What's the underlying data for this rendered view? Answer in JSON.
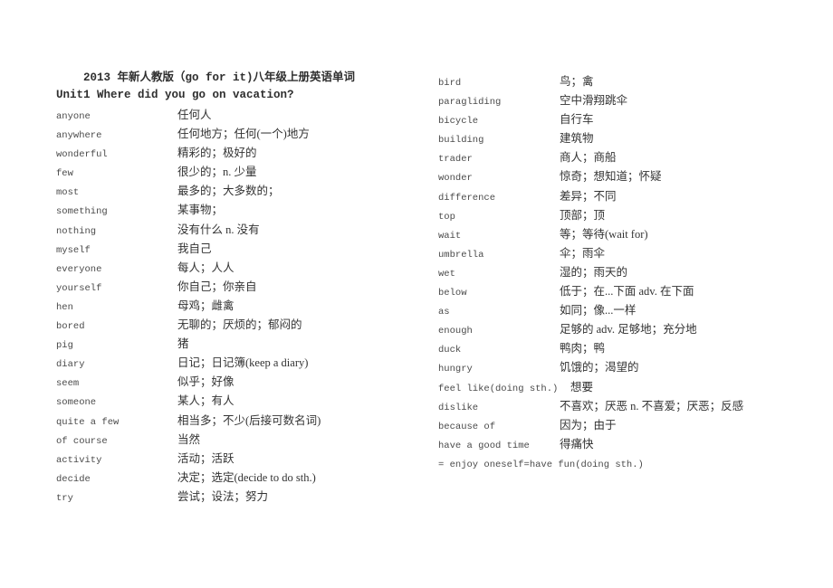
{
  "document": {
    "title": "2013 年新人教版（go for it)八年级上册英语单词",
    "unit_heading": "Unit1  Where did you go on vacation?"
  },
  "left_column": [
    {
      "term": "anyone",
      "gloss": "任何人"
    },
    {
      "term": "anywhere",
      "gloss": "任何地方；任何(一个)地方"
    },
    {
      "term": "wonderful",
      "gloss": "精彩的；极好的"
    },
    {
      "term": "few",
      "gloss": "很少的；n. 少量"
    },
    {
      "term": "most",
      "gloss": "最多的；大多数的；"
    },
    {
      "term": "something",
      "gloss": "某事物；"
    },
    {
      "term": "nothing",
      "gloss": "没有什么 n. 没有"
    },
    {
      "term": "myself",
      "gloss": "我自己"
    },
    {
      "term": "everyone",
      "gloss": "每人；人人"
    },
    {
      "term": "yourself",
      "gloss": "你自己；你亲自"
    },
    {
      "term": "hen",
      "gloss": "母鸡；雌禽"
    },
    {
      "term": "bored",
      "gloss": "无聊的；厌烦的；郁闷的"
    },
    {
      "term": "pig",
      "gloss": "猪"
    },
    {
      "term": "diary",
      "gloss": "日记；日记簿(keep a diary)"
    },
    {
      "term": "seem",
      "gloss": "似乎；好像"
    },
    {
      "term": "someone",
      "gloss": "某人；有人"
    },
    {
      "term": "quite a few",
      "gloss": "相当多；不少(后接可数名词)"
    },
    {
      "term": "of course",
      "gloss": "当然"
    },
    {
      "term": "activity",
      "gloss": "活动；活跃"
    },
    {
      "term": "decide",
      "gloss": "决定；选定(decide to do sth.)"
    },
    {
      "term": "try",
      "gloss": "尝试；设法；努力"
    }
  ],
  "right_column": [
    {
      "term": "bird",
      "gloss": "鸟；禽"
    },
    {
      "term": "paragliding",
      "gloss": "空中滑翔跳伞"
    },
    {
      "term": "bicycle",
      "gloss": "自行车"
    },
    {
      "term": "building",
      "gloss": "建筑物"
    },
    {
      "term": "trader",
      "gloss": "商人；商船"
    },
    {
      "term": "wonder",
      "gloss": "惊奇；想知道；怀疑"
    },
    {
      "term": "difference",
      "gloss": "差异；不同"
    },
    {
      "term": "top",
      "gloss": "顶部；顶"
    },
    {
      "term": "wait",
      "gloss": "等；等待(wait for)"
    },
    {
      "term": "umbrella",
      "gloss": "伞；雨伞"
    },
    {
      "term": "wet",
      "gloss": "湿的；雨天的"
    },
    {
      "term": "below",
      "gloss": "低于；在...下面 adv. 在下面"
    },
    {
      "term": "as",
      "gloss": "如同；像...一样"
    },
    {
      "term": "enough",
      "gloss": "足够的 adv. 足够地；充分地"
    },
    {
      "term": "duck",
      "gloss": "鸭肉；鸭"
    },
    {
      "term": "hungry",
      "gloss": "饥饿的；渴望的"
    },
    {
      "term": "feel like(doing sth.)",
      "gloss": "想要",
      "indent_gloss": true
    },
    {
      "term": "dislike",
      "gloss": "不喜欢；厌恶 n. 不喜爱；厌恶；反感"
    },
    {
      "term": "because of",
      "gloss": "因为；由于"
    },
    {
      "term": "have a good time",
      "gloss": "得痛快"
    },
    {
      "term": "= enjoy oneself=have fun(doing sth.)",
      "gloss": "",
      "full_width": true
    }
  ]
}
